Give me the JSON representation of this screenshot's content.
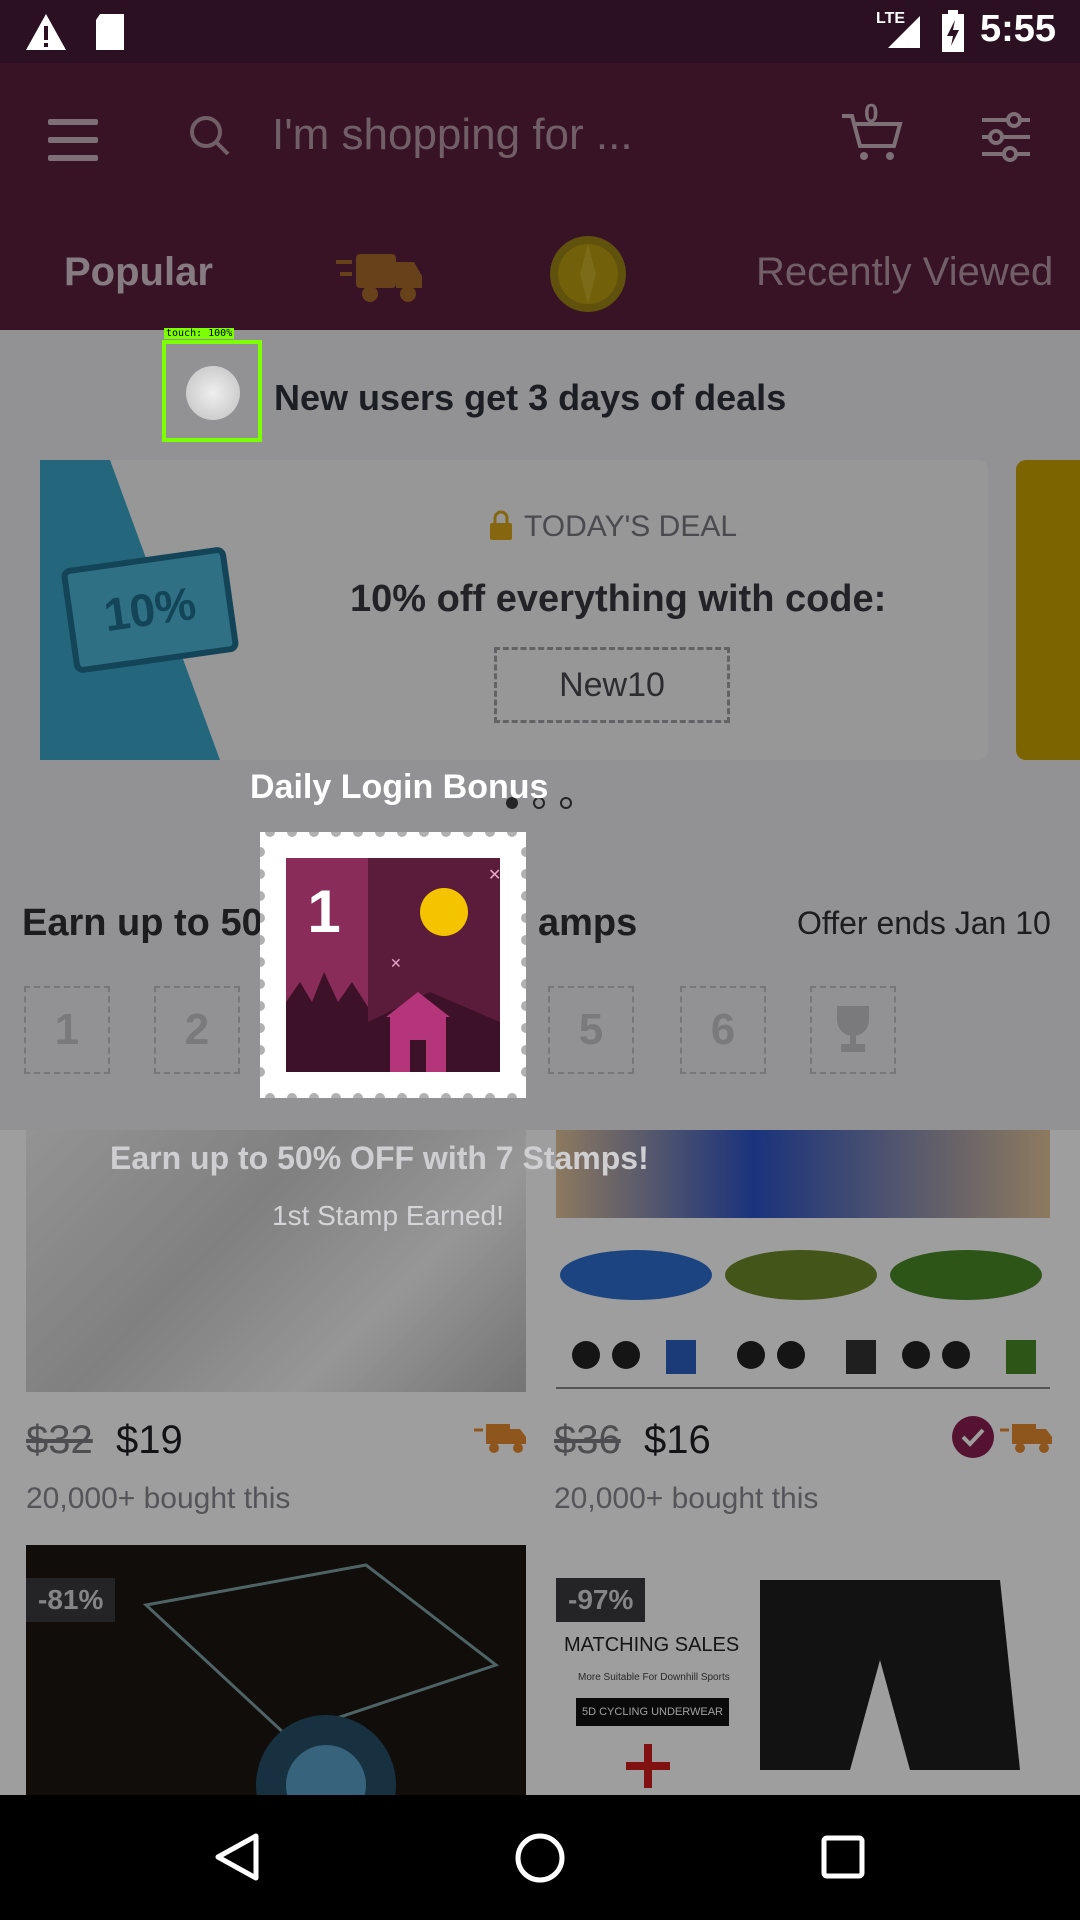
{
  "status_bar": {
    "time": "5:55",
    "network": "LTE"
  },
  "header": {
    "search_placeholder": "I'm shopping for ...",
    "cart_count": "0",
    "tabs": [
      {
        "label": "Popular"
      },
      {
        "label": "Recently Viewed"
      }
    ]
  },
  "promo": {
    "new_users": "New users get 3 days of deals"
  },
  "deal": {
    "badge": "10%",
    "label": "TODAY'S DEAL",
    "title": "10% off everything with code:",
    "code": "New10"
  },
  "stamps_section": {
    "title_part1": "Earn up to 50",
    "title_part2": "amps",
    "offer": "Offer ends Jan 10",
    "slots": [
      "1",
      "2",
      "5",
      "6"
    ]
  },
  "popup": {
    "title": "Daily Login Bonus",
    "stamp_number": "1",
    "headline": "Earn up to 50% OFF with 7 Stamps!",
    "subtitle": "1st Stamp Earned!"
  },
  "products": [
    {
      "old_price": "$32",
      "price": "$19",
      "bought": "20,000+ bought this"
    },
    {
      "old_price": "$36",
      "price": "$16",
      "bought": "20,000+ bought this"
    },
    {
      "discount": "-81%"
    },
    {
      "discount": "-97%",
      "text1": "MATCHING SALES",
      "text2": "More Suitable For Downhill Sports",
      "text3": "5D CYCLING UNDERWEAR"
    }
  ],
  "touch": {
    "label": "touch: 100%"
  },
  "colors": {
    "header": "#5b1d3d",
    "accent_yellow": "#f5c400",
    "stamp_bg": "#5a1c3a"
  }
}
